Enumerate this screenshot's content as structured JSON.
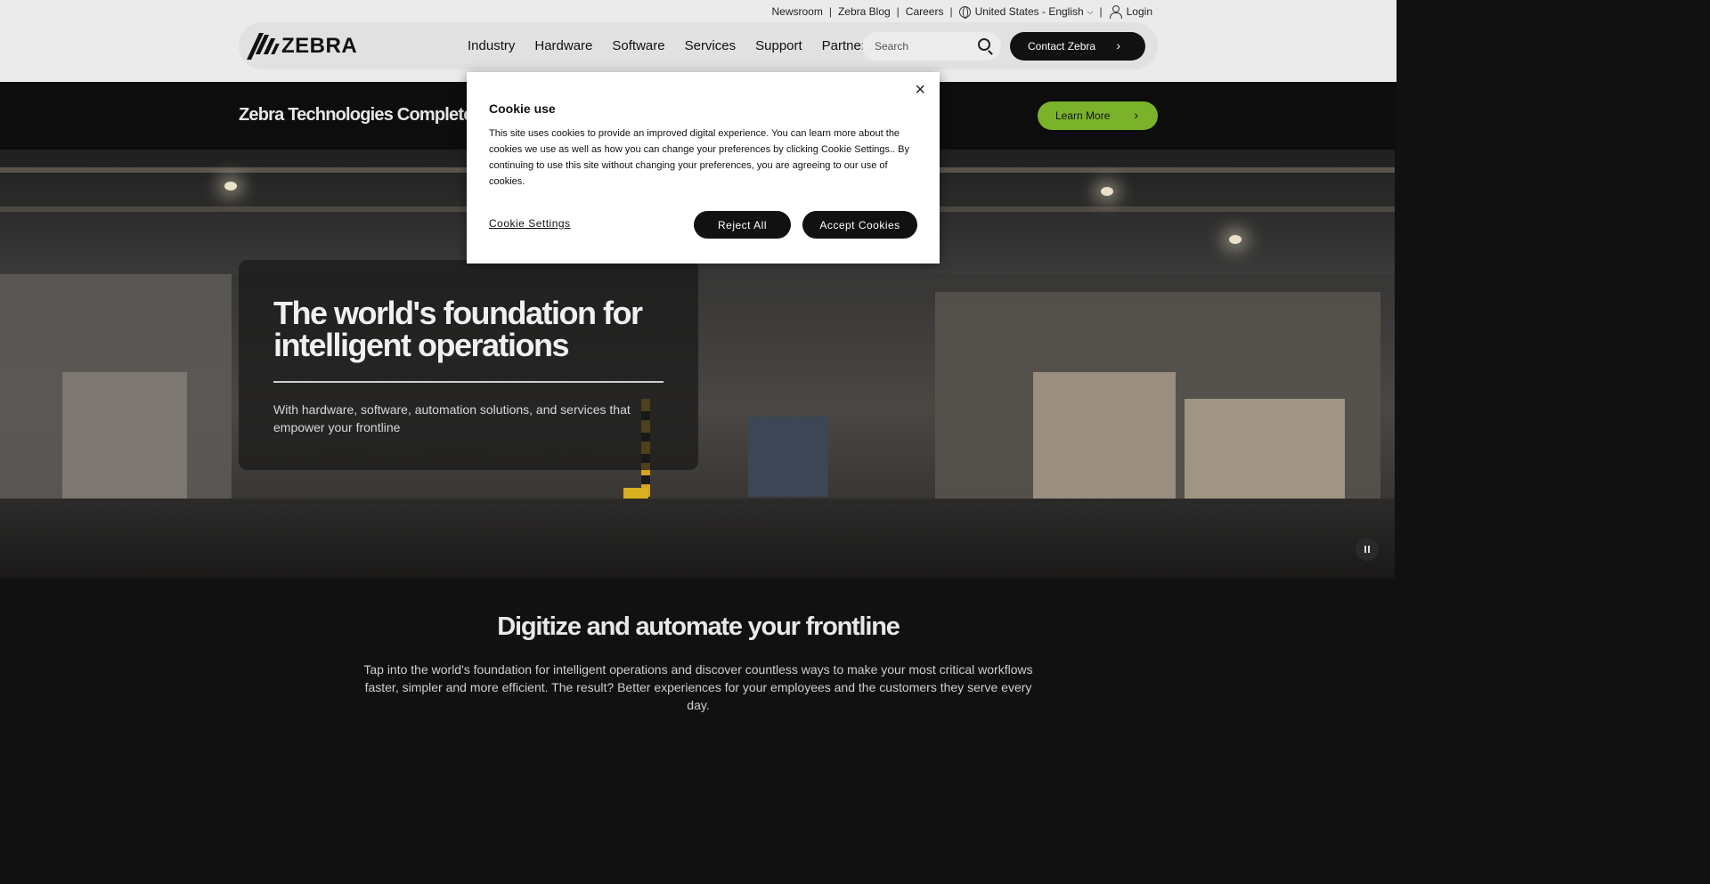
{
  "utility": {
    "links": [
      "Newsroom",
      "Zebra Blog",
      "Careers"
    ],
    "region": "United States - English",
    "login": "Login"
  },
  "nav": {
    "logo": "ZEBRA",
    "menu": [
      "Industry",
      "Hardware",
      "Software",
      "Services",
      "Support",
      "Partners"
    ],
    "search_placeholder": "Search",
    "contact": "Contact Zebra"
  },
  "announcement": {
    "title": "Zebra Technologies Completes Acquisition",
    "button": "Learn More"
  },
  "hero": {
    "heading": "The world's foundation for intelligent operations",
    "subtext": "With hardware, software, automation solutions, and services that empower your frontline"
  },
  "section": {
    "heading": "Digitize and automate your frontline",
    "text": "Tap into the world's foundation for intelligent operations and discover countless ways to make your most critical workflows faster, simpler and more efficient.  The result?  Better experiences for your employees and the customers they serve every day."
  },
  "cookie": {
    "title": "Cookie use",
    "body": "This site uses cookies to provide an improved digital experience. You can learn more about the cookies we use as well as how you can change your preferences by clicking Cookie Settings.. By continuing to use this site without changing your preferences, you are agreeing to our use of cookies.",
    "settings": "Cookie Settings",
    "reject": "Reject All",
    "accept": "Accept Cookies",
    "close": "×"
  },
  "colors": {
    "accent_green": "#7ab22a",
    "dark": "#111111",
    "header_bg": "#ebebeb"
  }
}
